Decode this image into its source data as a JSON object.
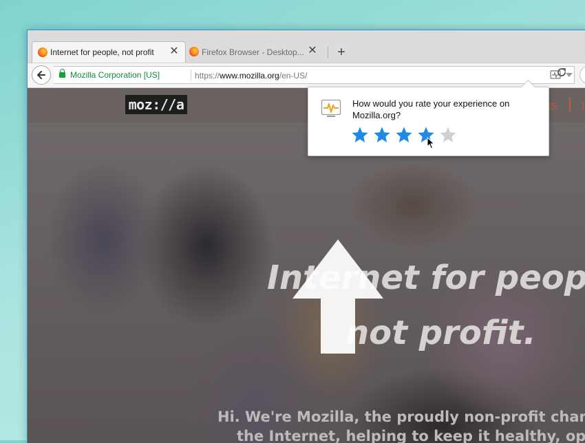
{
  "tabs": [
    {
      "label": "Internet for people, not profit",
      "active": true
    },
    {
      "label": "Firefox Browser - Desktop...",
      "active": false
    }
  ],
  "tab_close_glyph": "✕",
  "new_tab_glyph": "+",
  "urlbar": {
    "identity": "Mozilla Corporation [US]",
    "scheme": "https://",
    "host": "www.mozilla.org",
    "path": "/en-US/"
  },
  "site": {
    "wordmark": "moz://a",
    "nav_fragment": "NS",
    "nav_fragment2": "I",
    "hero_line1": "Internet for people,",
    "hero_line2": "not profit.",
    "hero_sub_line1": "Hi. We're Mozilla, the proudly non-profit champ",
    "hero_sub_line2": "the Internet, helping to keep it healthy, open"
  },
  "rating_panel": {
    "question": "How would you rate your experience on Mozilla.org?",
    "max_rating": 5,
    "hovered_rating": 4
  },
  "colors": {
    "star_active": "#1f8ae6",
    "star_inactive": "#d0d0d0",
    "identity_green": "#11883a",
    "icon_orange": "#f0a11a"
  },
  "icons": [
    "back-arrow-icon",
    "lock-icon",
    "page-action-icon",
    "dropmarker-icon",
    "reload-icon",
    "heartbeat-icon",
    "star-icon",
    "pointer-cursor-icon"
  ]
}
